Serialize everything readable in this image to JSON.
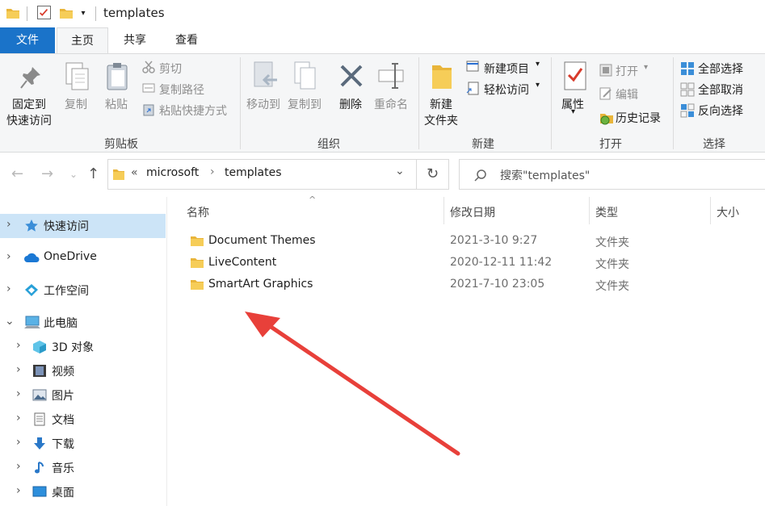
{
  "window": {
    "title": "templates"
  },
  "tabs": [
    {
      "label": "文件"
    },
    {
      "label": "主页"
    },
    {
      "label": "共享"
    },
    {
      "label": "查看"
    }
  ],
  "ribbon": {
    "clipboard": {
      "pin_line1": "固定到",
      "pin_line2": "快速访问",
      "copy": "复制",
      "paste": "粘贴",
      "cut": "剪切",
      "copy_path": "复制路径",
      "paste_shortcut": "粘贴快捷方式",
      "group": "剪贴板"
    },
    "organize": {
      "move_to": "移动到",
      "copy_to": "复制到",
      "delete": "删除",
      "rename": "重命名",
      "group": "组织"
    },
    "new": {
      "new_folder_line1": "新建",
      "new_folder_line2": "文件夹",
      "new_item": "新建项目",
      "easy_access": "轻松访问",
      "group": "新建"
    },
    "open": {
      "properties": "属性",
      "open": "打开",
      "edit": "编辑",
      "history": "历史记录",
      "group": "打开"
    },
    "select": {
      "select_all": "全部选择",
      "select_none": "全部取消",
      "invert": "反向选择",
      "group": "选择"
    }
  },
  "address": {
    "overflow": "«",
    "crumbs": [
      "microsoft",
      "templates"
    ],
    "search_placeholder": "搜索\"templates\""
  },
  "sidebar": {
    "items": [
      {
        "label": "快速访问"
      },
      {
        "label": "OneDrive"
      },
      {
        "label": "工作空间"
      },
      {
        "label": "此电脑"
      },
      {
        "label": "3D 对象"
      },
      {
        "label": "视频"
      },
      {
        "label": "图片"
      },
      {
        "label": "文档"
      },
      {
        "label": "下载"
      },
      {
        "label": "音乐"
      },
      {
        "label": "桌面"
      }
    ]
  },
  "columns": {
    "name": "名称",
    "date": "修改日期",
    "type": "类型",
    "size": "大小"
  },
  "files": [
    {
      "name": "Document Themes",
      "date": "2021-3-10 9:27",
      "type": "文件夹"
    },
    {
      "name": "LiveContent",
      "date": "2020-12-11 11:42",
      "type": "文件夹"
    },
    {
      "name": "SmartArt Graphics",
      "date": "2021-7-10 23:05",
      "type": "文件夹"
    }
  ],
  "colors": {
    "accent": "#1a73c9",
    "selection": "#cce4f7",
    "folder": "#f3c449",
    "arrow": "#e8403a"
  }
}
